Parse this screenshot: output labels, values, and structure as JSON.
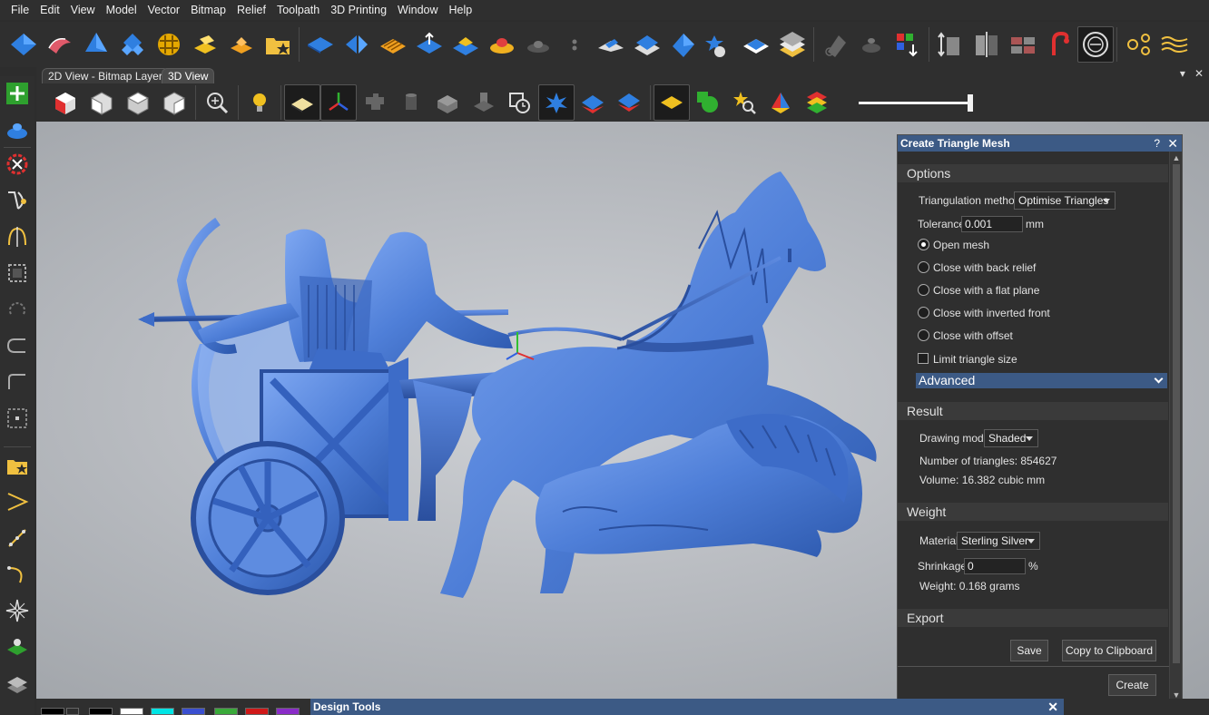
{
  "menu": [
    "File",
    "Edit",
    "View",
    "Model",
    "Vector",
    "Bitmap",
    "Relief",
    "Toolpath",
    "3D Printing",
    "Window",
    "Help"
  ],
  "tabs": [
    {
      "label": "2D View - Bitmap Layer"
    },
    {
      "label": "3D View"
    }
  ],
  "tabbar_controls": {
    "pin": "▾",
    "close": "✕"
  },
  "icons": {
    "main_toolbar": [
      "diamond-relief-icon",
      "smooth-relief-icon",
      "shape-editor-icon",
      "multi-shape-icon",
      "weave-icon",
      "extrude-icon",
      "pad-icon",
      "open-project-icon",
      "relief-plane-icon",
      "split-relief-icon",
      "texture-relief-icon",
      "offset-relief-icon",
      "pyramid-relief-icon",
      "bevel-relief-icon",
      "erase-relief-icon",
      "small-dot-icon",
      "angled-plane-icon",
      "stack-layers-icon",
      "cut-relief-icon",
      "dome-relief-icon",
      "flatten-relief-icon",
      "layers-icon",
      "eraser-icon",
      "ring-icon",
      "colour-select-icon",
      "scale-height-icon",
      "mirror-icon",
      "tile-icon",
      "sculpt-icon",
      "bezel-icon",
      "node-editor-icon",
      "text-on-curve-icon"
    ],
    "view_toolbar": [
      "iso-view-icon",
      "front-view-icon",
      "top-view-icon",
      "side-view-icon",
      "zoom-icon",
      "light-icon",
      "plane-icon",
      "axes-icon",
      "component-icon",
      "cylinder-icon",
      "block-icon",
      "assembly-icon",
      "snap-icon",
      "selected-relief-icon",
      "flat-shading-icon",
      "layered-shading-icon",
      "material-icon",
      "shape-tool-icon",
      "search-icon",
      "color-palette-icon",
      "layers-color-icon"
    ],
    "left_toolbar": [
      "add-layer-icon",
      "relief-layer-icon",
      "relief-clipboard-icon",
      "bezier-icon",
      "mirror-vector-icon",
      "select-box-icon",
      "rotate-icon",
      "arc-icon",
      "rectangle-icon",
      "frame-icon",
      "folder-star-icon",
      "polyline-icon",
      "spirograph-icon",
      "curve-icon",
      "star-icon",
      "layer-stack-icon",
      "multi-layer-icon"
    ]
  },
  "colors": {
    "accent": "#3c5a85",
    "relief_blue": "#4f7fd8",
    "swatches": [
      "#000000",
      "#000000",
      "#ffffff",
      "#00e5e5",
      "#3a4fd0",
      "#3aaa3a",
      "#d01818",
      "#8a2cc8"
    ]
  },
  "view_slider": {
    "fraction": 1.0
  },
  "dialog": {
    "title": "Create Triangle Mesh",
    "help": "?",
    "close": "✕",
    "options": {
      "header": "Options",
      "triangulation_label": "Triangulation method",
      "triangulation_value": "Optimise Triangles",
      "tolerance_label": "Tolerance",
      "tolerance_value": "0.001",
      "tolerance_unit": "mm",
      "radios": [
        {
          "label": "Open mesh",
          "checked": true
        },
        {
          "label": "Close with back relief",
          "checked": false
        },
        {
          "label": "Close with a flat plane",
          "checked": false
        },
        {
          "label": "Close with inverted front",
          "checked": false
        },
        {
          "label": "Close with offset",
          "checked": false
        }
      ],
      "limit_label": "Limit triangle size",
      "limit_checked": false,
      "advanced": "Advanced"
    },
    "result": {
      "header": "Result",
      "drawing_mode_label": "Drawing mode",
      "drawing_mode_value": "Shaded",
      "triangles": "Number of triangles: 854627",
      "volume": "Volume: 16.382 cubic mm"
    },
    "weight": {
      "header": "Weight",
      "material_label": "Material",
      "material_value": "Sterling Silver",
      "shrinkage_label": "Shrinkage",
      "shrinkage_value": "0",
      "shrinkage_unit": "%",
      "weight_text": "Weight: 0.168 grams"
    },
    "export": {
      "header": "Export",
      "save": "Save",
      "copy": "Copy to Clipboard"
    },
    "create": "Create"
  },
  "design_tools": {
    "title": "Design Tools",
    "close": "✕"
  }
}
